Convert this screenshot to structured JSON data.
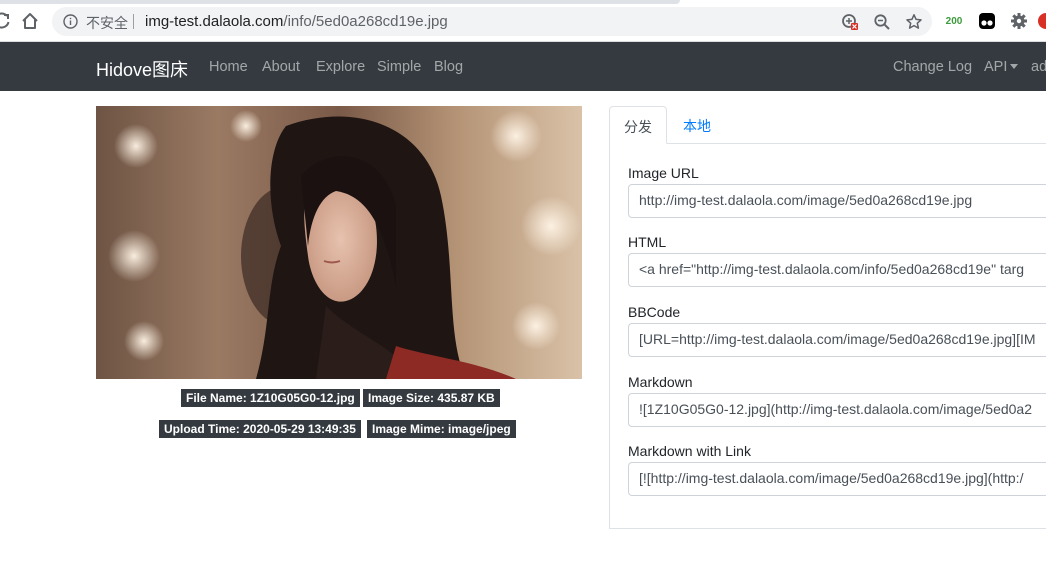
{
  "browser": {
    "security_label": "不安全",
    "url_host": "img-test.dalaola.com",
    "url_path": "/info/5ed0a268cd19e.jpg",
    "extension_badge": "200"
  },
  "navbar": {
    "brand": "Hidove图床",
    "links": [
      "Home",
      "About",
      "Explore",
      "Simple",
      "Blog"
    ],
    "right_links": [
      "Change Log",
      "API",
      "ad"
    ]
  },
  "image_info": {
    "file_name": "File Name: 1Z10G05G0-12.jpg",
    "image_size": "Image Size: 435.87 KB",
    "upload_time": "Upload Time: 2020-05-29 13:49:35",
    "image_mime": "Image Mime: image/jpeg"
  },
  "tabs": [
    "分发",
    "本地"
  ],
  "fields": [
    {
      "label": "Image URL",
      "value": "http://img-test.dalaola.com/image/5ed0a268cd19e.jpg"
    },
    {
      "label": "HTML",
      "value": "<a href=\"http://img-test.dalaola.com/info/5ed0a268cd19e\" targ"
    },
    {
      "label": "BBCode",
      "value": "[URL=http://img-test.dalaola.com/image/5ed0a268cd19e.jpg][IM"
    },
    {
      "label": "Markdown",
      "value": "![1Z10G05G0-12.jpg](http://img-test.dalaola.com/image/5ed0a2"
    },
    {
      "label": "Markdown with Link",
      "value": "[![http://img-test.dalaola.com/image/5ed0a268cd19e.jpg](http:/"
    }
  ],
  "colors": {
    "navbar_bg": "#343a40",
    "link_blue": "#007bff",
    "badge_bg": "#343a40"
  }
}
